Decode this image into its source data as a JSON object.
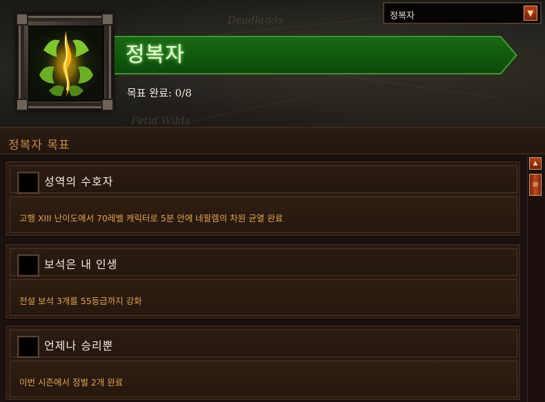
{
  "header": {
    "title": "정복자",
    "progress_label": "목표 완료: 0/8",
    "map_labels": [
      "Deadlands",
      "Fetid Wilds"
    ],
    "icon": "conqueror-emblem-icon",
    "banner_color": "#156010"
  },
  "dropdown": {
    "selected": "정복자",
    "arrow_icon": "chevron-down-icon"
  },
  "section": {
    "title": "정복자 목표"
  },
  "objectives": [
    {
      "name": "성역의 수호자",
      "description": "고행 XIII 난이도에서 70레벨 캐릭터로 5분 안에 네팔렘의 차원 균열 완료",
      "completed": false
    },
    {
      "name": "보석은 내 인생",
      "description": "전설 보석 3개를 55등급까지 강화",
      "completed": false
    },
    {
      "name": "언제나 승리뿐",
      "description": "이번 시즌에서 정벌 2개 완료",
      "completed": false
    }
  ],
  "scrollbar": {
    "up_icon": "arrow-up-icon",
    "thumb_icon": "grip-icon"
  }
}
